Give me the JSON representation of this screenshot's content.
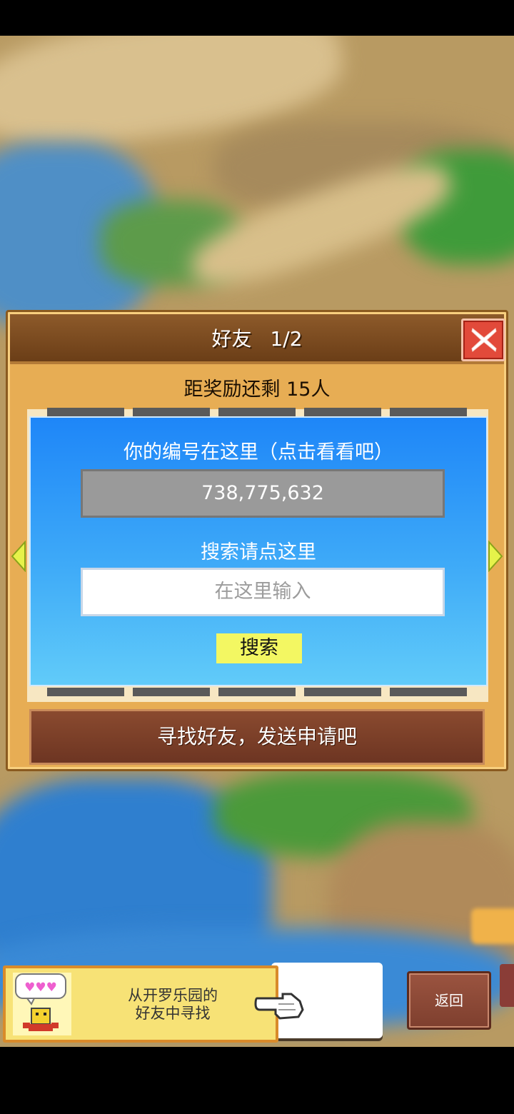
{
  "dialog": {
    "title": "好友",
    "page": "1/2",
    "reward_text": "距奖励还剩 15人",
    "id_label": "你的编号在这里（点击看看吧）",
    "player_id": "738,775,632",
    "search_label": "搜索请点这里",
    "search_placeholder": "在这里输入",
    "search_button": "搜索",
    "find_friends_button": "寻找好友，发送申请吧"
  },
  "bottom": {
    "kairo_text_line1": "从开罗乐园的",
    "kairo_text_line2": "好友中寻找",
    "back_button": "返回"
  },
  "colors": {
    "panel_blue": "#1e86f8",
    "search_button_yellow": "#f3f762",
    "close_red": "#e24a3a",
    "frame_orange": "#e7ad54"
  },
  "icons": [
    "close-icon",
    "left-arrow-icon",
    "right-arrow-icon",
    "kairo-mascot-icon",
    "pointing-hand-icon"
  ]
}
